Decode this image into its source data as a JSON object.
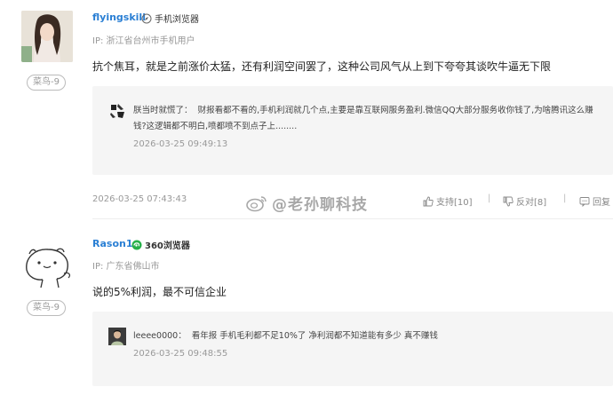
{
  "comments": [
    {
      "username": "flyingskill",
      "browser": "手机浏览器",
      "ip": "IP: 浙江省台州市手机用户",
      "level": "菜鸟-9",
      "text": "抗个焦耳，就是之前涨价太猛，还有利润空间罢了，这种公司风气从上到下夸夸其谈吹牛逼无下限",
      "quote": {
        "name": "朕当时就慌了：",
        "text": "财报看都不看的,手机利润就几个点,主要是靠互联网服务盈利.微信QQ大部分服务收你钱了,为啥腾讯这么赚钱?这逻辑都不明白,喷都喷不到点子上........",
        "time": "2026-03-25 09:49:13"
      },
      "time": "2026-03-25 07:43:43",
      "support": "支持[10]",
      "oppose": "反对[8]",
      "reply": "回复"
    },
    {
      "username": "Rason1",
      "browser": "360浏览器",
      "ip": "IP: 广东省佛山市",
      "level": "菜鸟-9",
      "text": "说的5%利润，最不可信企业",
      "quote": {
        "name": "leeee0000：",
        "text": "看年报 手机毛利都不足10%了 净利润都不知道能有多少 真不赚钱",
        "time": "2026-03-25 09:48:55"
      }
    }
  ],
  "watermark": "@老孙聊科技",
  "colors": {
    "username": "#2a7fd4",
    "quote_bg": "#f5f5f5",
    "muted": "#999999"
  }
}
